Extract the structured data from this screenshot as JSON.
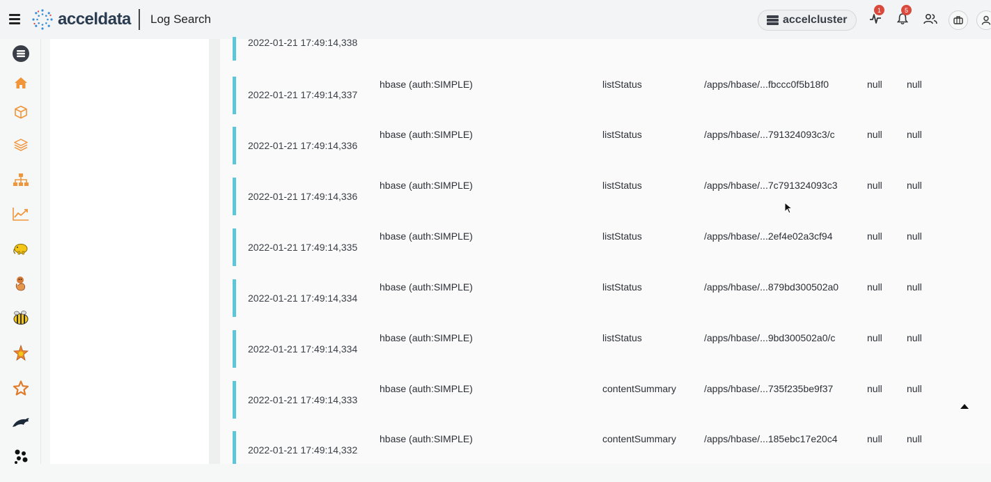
{
  "header": {
    "brand": "acceldata",
    "page_title": "Log Search",
    "cluster_name": "accelcluster",
    "activity_badge": "1",
    "notifications_badge": "5"
  },
  "colors": {
    "accent_bar": "#5cc7d9",
    "badge": "#d94a3d",
    "nav_orange": "#f0953a"
  },
  "nav": {
    "items": [
      "database-icon",
      "home-icon",
      "cube-icon",
      "layers-icon",
      "sitemap-icon",
      "chart-line-icon",
      "hadoop-elephant-icon",
      "zookeeper-icon",
      "hive-bee-icon",
      "spark-icon",
      "star-icon",
      "kafka-dolphin-icon",
      "cluster-dots-icon"
    ]
  },
  "results": {
    "rows": [
      {
        "timestamp": "2022-01-21 17:49:14,338",
        "user": "",
        "operation": "",
        "path": "",
        "c1": "",
        "c2": ""
      },
      {
        "timestamp": "2022-01-21 17:49:14,337",
        "user": "hbase (auth:SIMPLE)",
        "operation": "listStatus",
        "path": "/apps/hbase/...fbccc0f5b18f0",
        "c1": "null",
        "c2": "null"
      },
      {
        "timestamp": "2022-01-21 17:49:14,336",
        "user": "hbase (auth:SIMPLE)",
        "operation": "listStatus",
        "path": "/apps/hbase/...791324093c3/c",
        "c1": "null",
        "c2": "null"
      },
      {
        "timestamp": "2022-01-21 17:49:14,336",
        "user": "hbase (auth:SIMPLE)",
        "operation": "listStatus",
        "path": "/apps/hbase/...7c791324093c3",
        "c1": "null",
        "c2": "null"
      },
      {
        "timestamp": "2022-01-21 17:49:14,335",
        "user": "hbase (auth:SIMPLE)",
        "operation": "listStatus",
        "path": "/apps/hbase/...2ef4e02a3cf94",
        "c1": "null",
        "c2": "null"
      },
      {
        "timestamp": "2022-01-21 17:49:14,334",
        "user": "hbase (auth:SIMPLE)",
        "operation": "listStatus",
        "path": "/apps/hbase/...879bd300502a0",
        "c1": "null",
        "c2": "null"
      },
      {
        "timestamp": "2022-01-21 17:49:14,334",
        "user": "hbase (auth:SIMPLE)",
        "operation": "listStatus",
        "path": "/apps/hbase/...9bd300502a0/c",
        "c1": "null",
        "c2": "null"
      },
      {
        "timestamp": "2022-01-21 17:49:14,333",
        "user": "hbase (auth:SIMPLE)",
        "operation": "contentSummary",
        "path": "/apps/hbase/...735f235be9f37",
        "c1": "null",
        "c2": "null"
      },
      {
        "timestamp": "2022-01-21 17:49:14,332",
        "user": "hbase (auth:SIMPLE)",
        "operation": "contentSummary",
        "path": "/apps/hbase/...185ebc17e20c4",
        "c1": "null",
        "c2": "null"
      }
    ]
  }
}
